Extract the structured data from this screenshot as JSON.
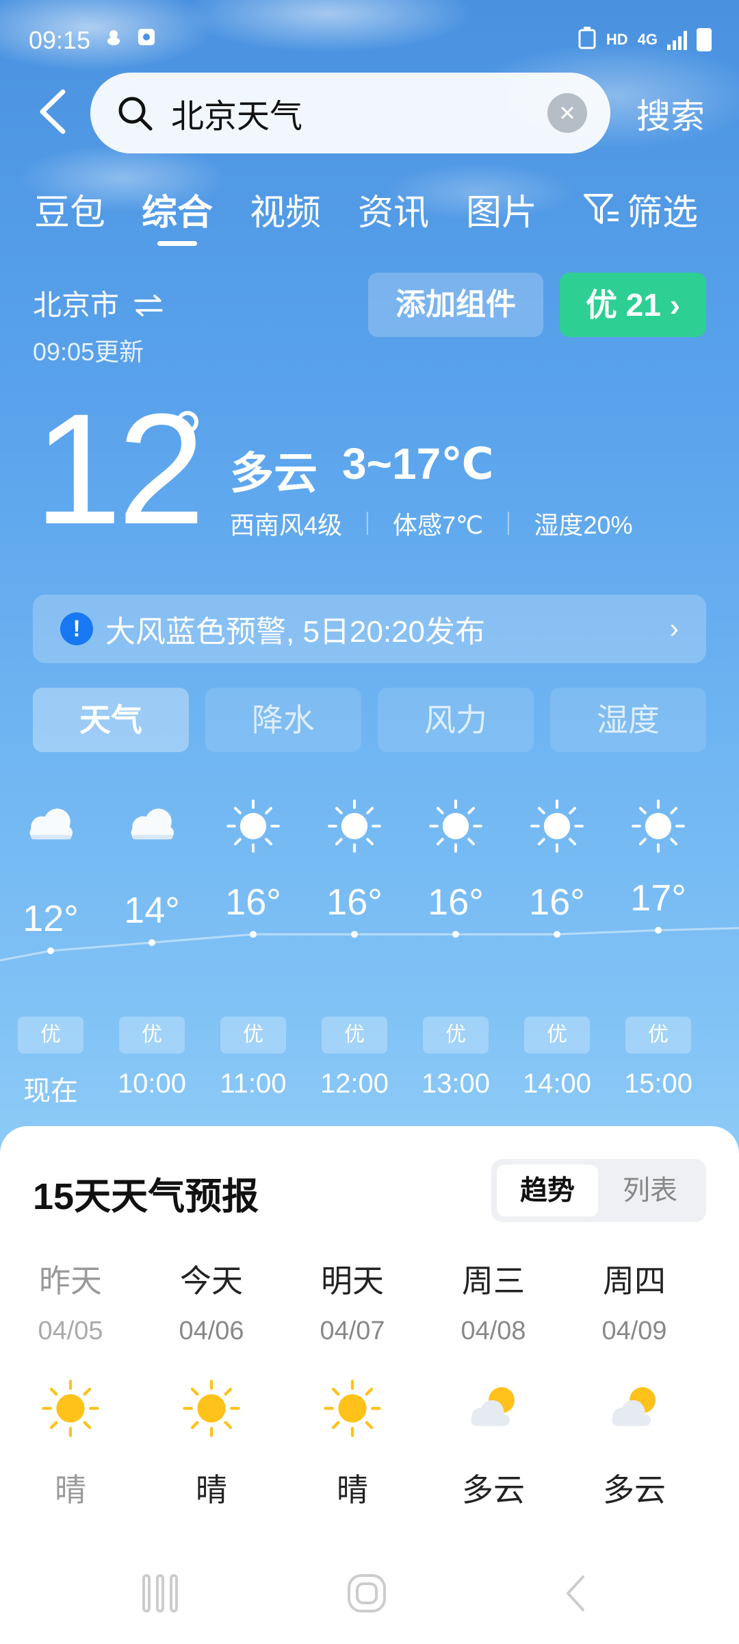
{
  "status_bar": {
    "time": "09:15",
    "network": "HD",
    "signal": "4G"
  },
  "search": {
    "query": "北京天气",
    "submit_label": "搜索"
  },
  "tabs": [
    {
      "label": "豆包"
    },
    {
      "label": "综合"
    },
    {
      "label": "视频"
    },
    {
      "label": "资讯"
    },
    {
      "label": "图片"
    },
    {
      "label": "筛选"
    }
  ],
  "active_tab": "综合",
  "location": {
    "city": "北京市",
    "updated": "09:05更新"
  },
  "actions": {
    "add_widget": "添加组件",
    "aqi_label": "优 21 ›"
  },
  "current": {
    "temp": "12",
    "condition": "多云",
    "range": "3~17℃",
    "wind": "西南风4级",
    "feels_like": "体感7℃",
    "humidity": "湿度20%"
  },
  "alert": {
    "text": "大风蓝色预警, 5日20:20发布",
    "icon": "!"
  },
  "subtabs": [
    {
      "label": "天气"
    },
    {
      "label": "降水"
    },
    {
      "label": "风力"
    },
    {
      "label": "湿度"
    }
  ],
  "hourly": [
    {
      "icon": "cloud-icon",
      "temp": "12°",
      "aqi": "优",
      "time": "现在"
    },
    {
      "icon": "cloud-icon",
      "temp": "14°",
      "aqi": "优",
      "time": "10:00"
    },
    {
      "icon": "sun-icon",
      "temp": "16°",
      "aqi": "优",
      "time": "11:00"
    },
    {
      "icon": "sun-icon",
      "temp": "16°",
      "aqi": "优",
      "time": "12:00"
    },
    {
      "icon": "sun-icon",
      "temp": "16°",
      "aqi": "优",
      "time": "13:00"
    },
    {
      "icon": "sun-icon",
      "temp": "16°",
      "aqi": "优",
      "time": "14:00"
    },
    {
      "icon": "sun-icon",
      "temp": "17°",
      "aqi": "优",
      "time": "15:00"
    }
  ],
  "forecast": {
    "title": "15天天气预报",
    "toggle": {
      "trend": "趋势",
      "list": "列表"
    },
    "days": [
      {
        "name": "昨天",
        "date": "04/05",
        "icon": "sun-icon",
        "condition": "晴"
      },
      {
        "name": "今天",
        "date": "04/06",
        "icon": "sun-icon",
        "condition": "晴"
      },
      {
        "name": "明天",
        "date": "04/07",
        "icon": "sun-icon",
        "condition": "晴"
      },
      {
        "name": "周三",
        "date": "04/08",
        "icon": "partly-cloudy-icon",
        "condition": "多云"
      },
      {
        "name": "周四",
        "date": "04/09",
        "icon": "partly-cloudy-icon",
        "condition": "多云"
      }
    ]
  },
  "colors": {
    "aqi_good": "#2ecf93",
    "alert_icon": "#1877f2",
    "sun": "#ffc21a"
  }
}
